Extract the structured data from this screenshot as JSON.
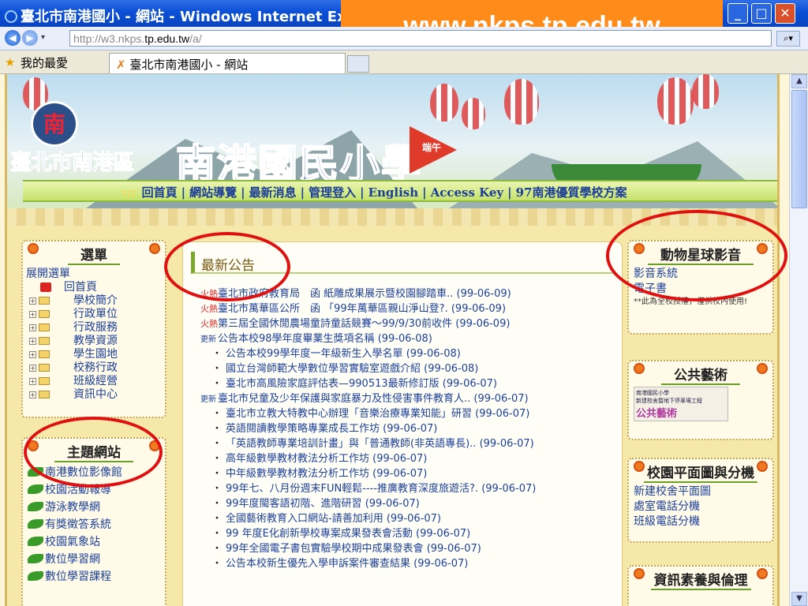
{
  "window": {
    "title": "臺北市南港國小 - 網站 - Windows Internet Explorer",
    "url_banner": "www.nkps.tp.edu.tw",
    "controls": {
      "minimize": "_",
      "maximize": "□",
      "close": "✕"
    }
  },
  "address": {
    "prefix": "http://w3.nkps.",
    "domain": "tp.edu.tw",
    "suffix": "/a/"
  },
  "favorites": {
    "label": "我的最愛",
    "tab_title": "臺北市南港國小 - 網站"
  },
  "site": {
    "logo_text": "南",
    "district": "臺北市南港區",
    "school_name": "南港國民小學",
    "flag_text": "端午",
    "nav": [
      "回首頁",
      "網站導覽",
      "最新消息",
      "管理登入",
      "English",
      "Access Key",
      "97南港優質學校方案"
    ]
  },
  "menu": {
    "title": "選單",
    "expand": "展開選單",
    "home": "回首頁",
    "items": [
      "學校簡介",
      "行政單位",
      "行政服務",
      "教學資源",
      "學生園地",
      "校務行政",
      "班級經營",
      "資訊中心"
    ]
  },
  "theme": {
    "title": "主題網站",
    "items": [
      "南港數位影像館",
      "校園活動報導",
      "游泳教學網",
      "有獎徵答系統",
      "校園氣象站",
      "數位學習網",
      "數位學習課程"
    ]
  },
  "news": {
    "title": "最新公告",
    "items": [
      {
        "badge": "hot",
        "indent": false,
        "text": "臺北市政府教育局　函 紙雕成果展示暨校園腳踏車..",
        "date": "(99-06-09)"
      },
      {
        "badge": "hot",
        "indent": false,
        "text": "臺北市萬華區公所　函 「99年萬華區親山淨山登?.",
        "date": "(99-06-09)"
      },
      {
        "badge": "hot",
        "indent": false,
        "text": "第三屆全國休閒農場童詩童話競賽～99/9/30前收件",
        "date": "(99-06-09)"
      },
      {
        "badge": "new",
        "indent": false,
        "text": "公告本校98學年度畢業生獎項名稱",
        "date": "(99-06-08)"
      },
      {
        "badge": "dot",
        "indent": true,
        "text": "公告本校99學年度一年級新生入學名單",
        "date": "(99-06-08)"
      },
      {
        "badge": "dot",
        "indent": true,
        "text": "國立台灣師範大學數位學習實驗室遊戲介紹",
        "date": "(99-06-08)"
      },
      {
        "badge": "dot",
        "indent": true,
        "text": "臺北市高風險家庭評估表—990513最新修訂版",
        "date": "(99-06-07)"
      },
      {
        "badge": "new",
        "indent": false,
        "text": "臺北市兒童及少年保護與家庭暴力及性侵害事件教育人..",
        "date": "(99-06-07)"
      },
      {
        "badge": "dot",
        "indent": true,
        "text": "臺北市立教大特教中心辦理「音樂治療專業知能」研習",
        "date": "(99-06-07)"
      },
      {
        "badge": "dot",
        "indent": true,
        "text": "英語閱讀教學策略專業成長工作坊",
        "date": "(99-06-07)"
      },
      {
        "badge": "dot",
        "indent": true,
        "text": "「英語教師專業培訓計畫」與「普通教師(非英語專長)..",
        "date": "(99-06-07)"
      },
      {
        "badge": "dot",
        "indent": true,
        "text": "高年級數學教材教法分析工作坊",
        "date": "(99-06-07)"
      },
      {
        "badge": "dot",
        "indent": true,
        "text": "中年級數學教材教法分析工作坊",
        "date": "(99-06-07)"
      },
      {
        "badge": "dot",
        "indent": true,
        "text": "99年七、八月份週末FUN輕鬆----推廣教育深度旅遊活?.",
        "date": "(99-06-07)"
      },
      {
        "badge": "dot",
        "indent": true,
        "text": "99年度閩客語初階、進階研習",
        "date": "(99-06-07)"
      },
      {
        "badge": "dot",
        "indent": true,
        "text": "全國藝術教育入口網站-請善加利用",
        "date": "(99-06-07)"
      },
      {
        "badge": "dot",
        "indent": true,
        "text": "99 年度E化創新學校專案成果發表會活動",
        "date": "(99-06-07)"
      },
      {
        "badge": "dot",
        "indent": true,
        "text": "99年全國電子書包實驗學校期中成果發表會",
        "date": "(99-06-07)"
      },
      {
        "badge": "dot",
        "indent": true,
        "text": "公告本校新生優先入學申訴案件審查結果",
        "date": "(99-06-07)"
      }
    ],
    "badges": {
      "hot": "火熱",
      "new": "更新",
      "dot": "・"
    }
  },
  "animal": {
    "title": "動物星球影音",
    "links": [
      "影音系統",
      "電子書"
    ],
    "note": "**此為全校授權，僅供校內使用!"
  },
  "public_art": {
    "title": "公共藝術",
    "line1": "南港國民小學",
    "line2": "新建校舍暨地下停車場工程",
    "brand": "公共藝術"
  },
  "floorplan": {
    "title": "校園平面圖與分機",
    "links": [
      "新建校舍平面圖",
      "處室電話分機",
      "班級電話分機"
    ]
  },
  "infoethics": {
    "title": "資訊素養與倫理"
  }
}
